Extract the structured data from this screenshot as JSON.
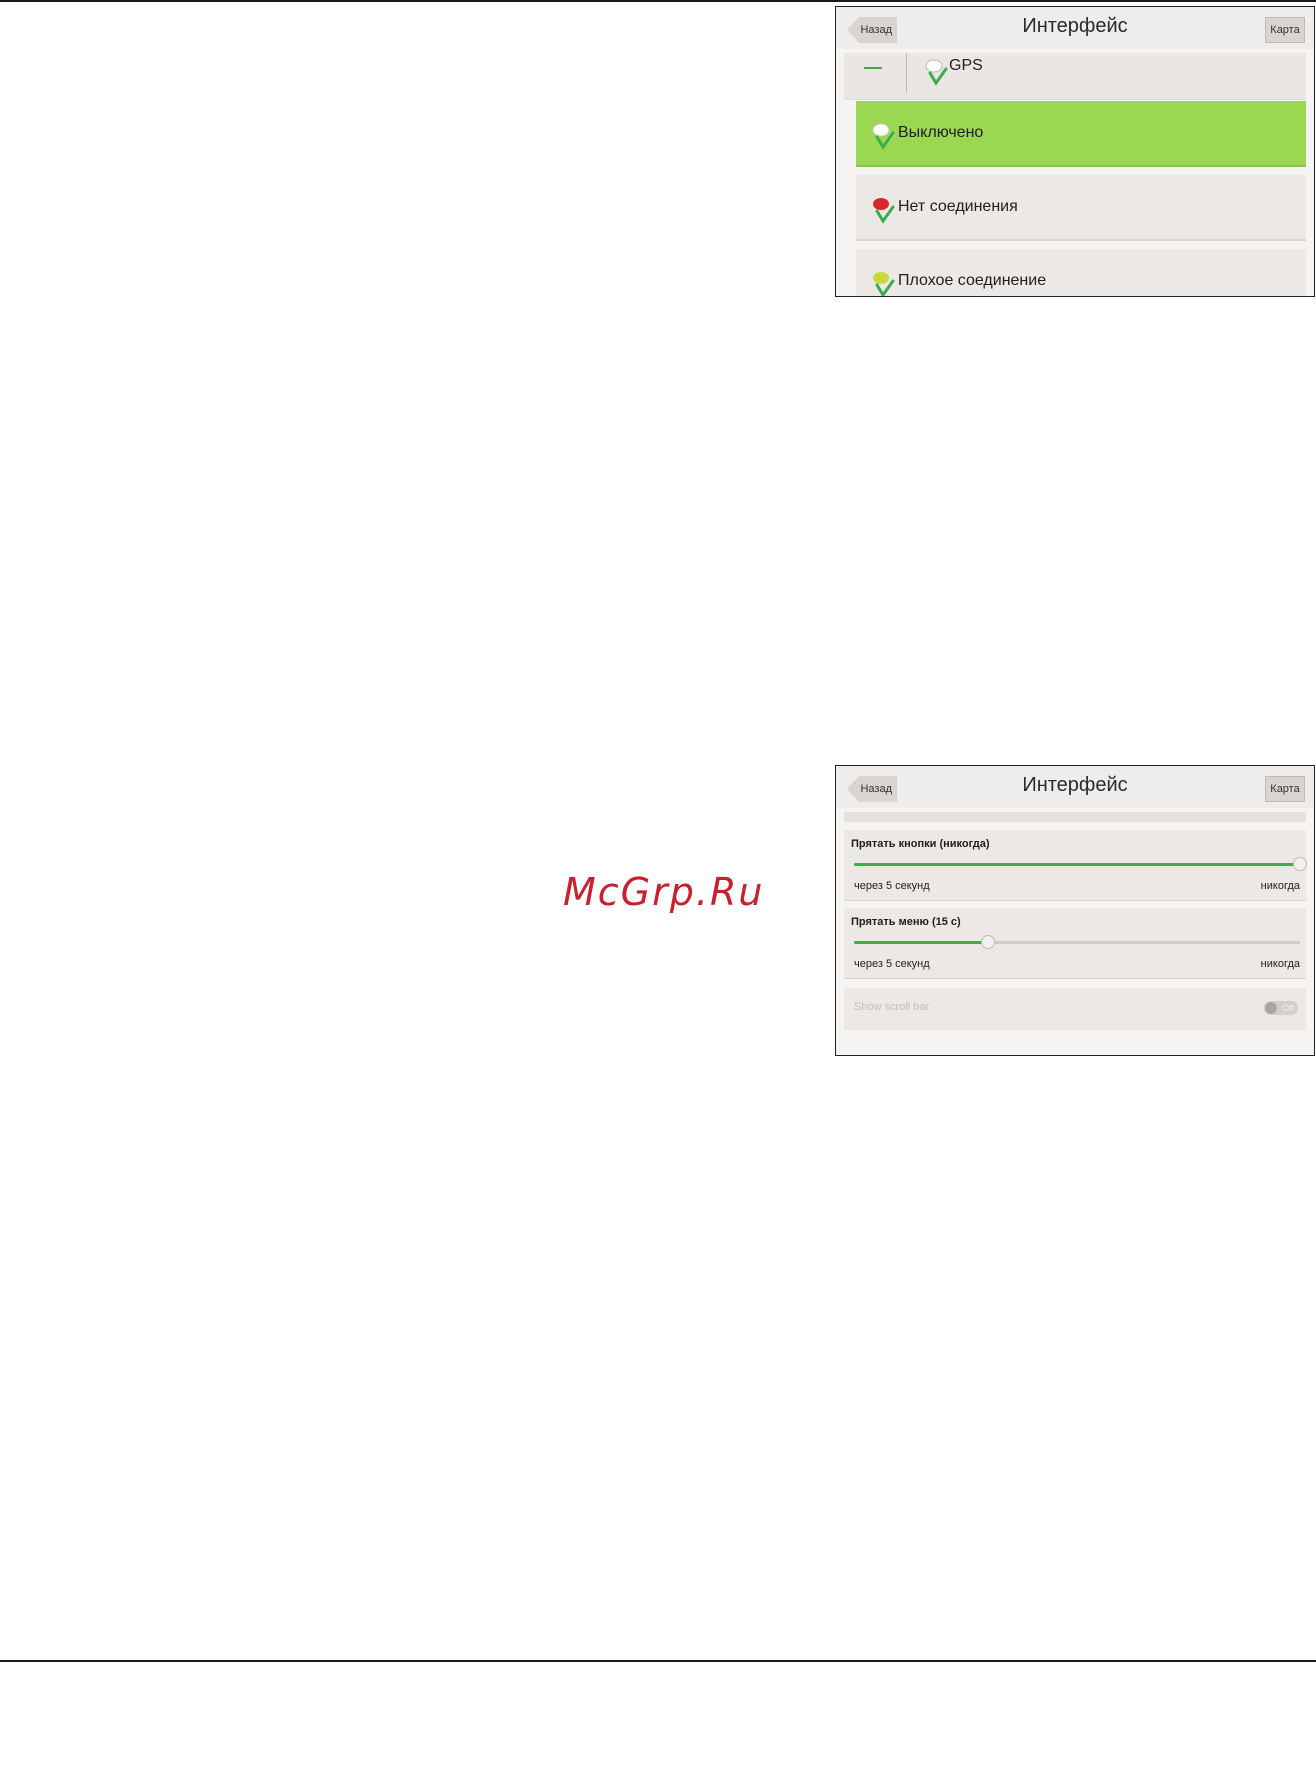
{
  "watermark": "McGrp.Ru",
  "screens": [
    {
      "header": {
        "back": "Назад",
        "title": "Интерфейс",
        "map": "Карта"
      },
      "gps_label": "GPS",
      "options": [
        {
          "label": "Выключено",
          "selected": true,
          "icon": "gps-off-icon"
        },
        {
          "label": "Нет соединения",
          "selected": false,
          "icon": "gps-no-connection-icon"
        },
        {
          "label": "Плохое соединение",
          "selected": false,
          "icon": "gps-poor-connection-icon"
        }
      ]
    },
    {
      "header": {
        "back": "Назад",
        "title": "Интерфейс",
        "map": "Карта"
      },
      "sliders": [
        {
          "label": "Прятать кнопки (никогда)",
          "min_label": "через 5 секунд",
          "max_label": "никогда",
          "value_fraction": 1.0
        },
        {
          "label": "Прятать меню (15 с)",
          "min_label": "через 5 секунд",
          "max_label": "никогда",
          "value_fraction": 0.3
        }
      ],
      "toggle": {
        "label": "Show scroll bar",
        "state": "Off"
      }
    }
  ],
  "colors": {
    "selected": "#9bd852",
    "slider_fill": "#3aae48",
    "watermark": "#c8202c"
  }
}
